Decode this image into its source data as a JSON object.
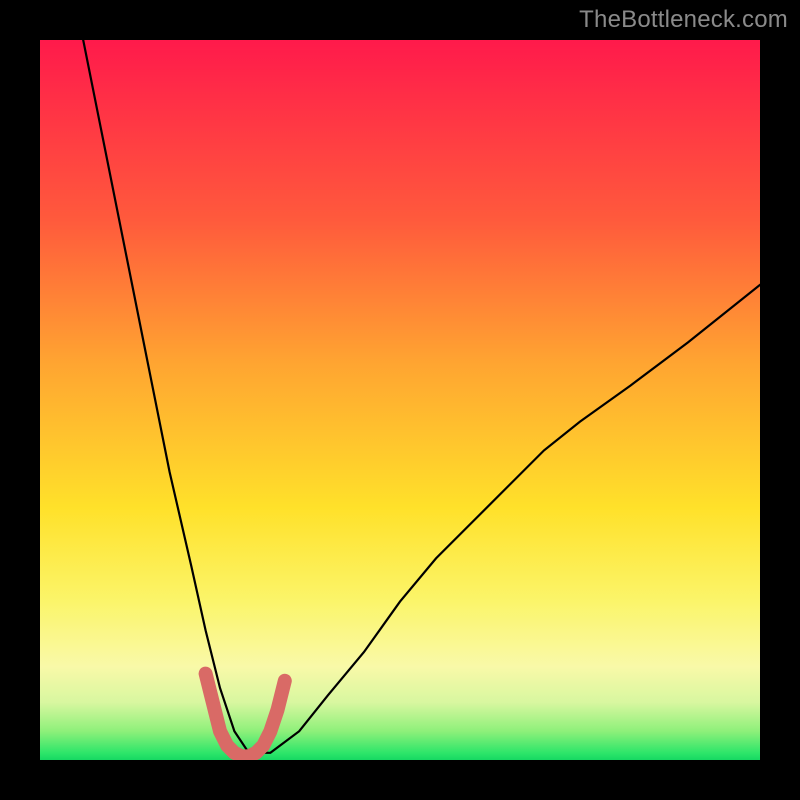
{
  "watermark": "TheBottleneck.com",
  "chart_data": {
    "type": "line",
    "title": "",
    "xlabel": "",
    "ylabel": "",
    "xlim": [
      0,
      100
    ],
    "ylim": [
      0,
      100
    ],
    "grid": false,
    "series": [
      {
        "name": "bottleneck-curve",
        "color": "#000000",
        "x": [
          6,
          9,
          12,
          15,
          18,
          21,
          23,
          25,
          27,
          29,
          32,
          36,
          40,
          45,
          50,
          55,
          60,
          65,
          70,
          75,
          82,
          90,
          100
        ],
        "y": [
          100,
          85,
          70,
          55,
          40,
          27,
          18,
          10,
          4,
          1,
          1,
          4,
          9,
          15,
          22,
          28,
          33,
          38,
          43,
          47,
          52,
          58,
          66
        ]
      },
      {
        "name": "valley-highlight",
        "color": "#d96a66",
        "x": [
          23,
          24,
          25,
          26,
          27,
          28,
          29,
          30,
          31,
          32,
          33,
          34
        ],
        "y": [
          12,
          8,
          4,
          2,
          1,
          0.5,
          0.5,
          1,
          2,
          4,
          7,
          11
        ]
      }
    ],
    "background_gradient": {
      "top": "#ff1a4b",
      "mid1": "#ffa531",
      "mid2": "#ffe12a",
      "bottom": "#16d862"
    }
  }
}
